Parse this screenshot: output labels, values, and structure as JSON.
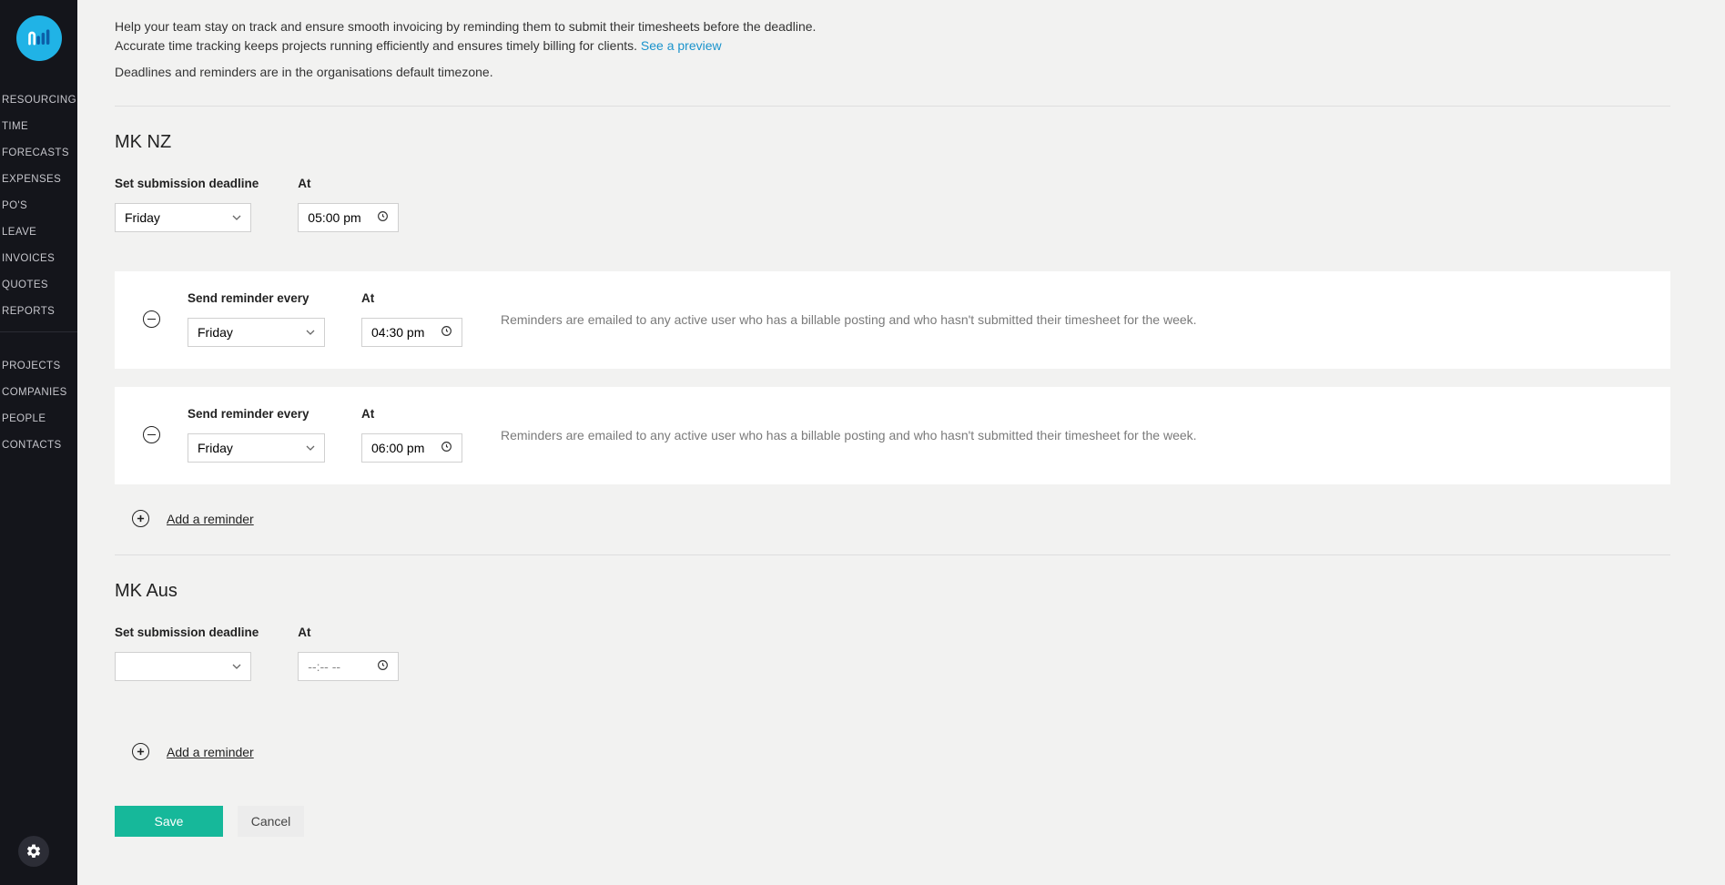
{
  "sidebar": {
    "groups": [
      [
        "RESOURCING",
        "TIME",
        "FORECASTS",
        "EXPENSES",
        "PO'S",
        "LEAVE",
        "INVOICES",
        "QUOTES",
        "REPORTS"
      ],
      [
        "PROJECTS",
        "COMPANIES",
        "PEOPLE",
        "CONTACTS"
      ]
    ]
  },
  "intro": {
    "line1": "Help your team stay on track and ensure smooth invoicing by reminding them to submit their timesheets before the deadline.",
    "line2a": "Accurate time tracking keeps projects running efficiently and ensures timely billing for clients. ",
    "preview_link": "See a preview",
    "timezone_note": "Deadlines and reminders are in the organisations default timezone."
  },
  "labels": {
    "deadline": "Set submission deadline",
    "at": "At",
    "send_every": "Send reminder every",
    "add_reminder": "Add a reminder",
    "save": "Save",
    "cancel": "Cancel"
  },
  "reminder_note": "Reminders are emailed to any active user who has a billable posting and who hasn't submitted their timesheet for the week.",
  "sections": {
    "mknz": {
      "title": "MK NZ",
      "deadline_day": "Friday",
      "deadline_time": "05:00 pm",
      "reminders": [
        {
          "day": "Friday",
          "time": "04:30 pm"
        },
        {
          "day": "Friday",
          "time": "06:00 pm"
        }
      ]
    },
    "mkaus": {
      "title": "MK Aus",
      "deadline_day": "",
      "deadline_time": "--:-- --"
    }
  }
}
